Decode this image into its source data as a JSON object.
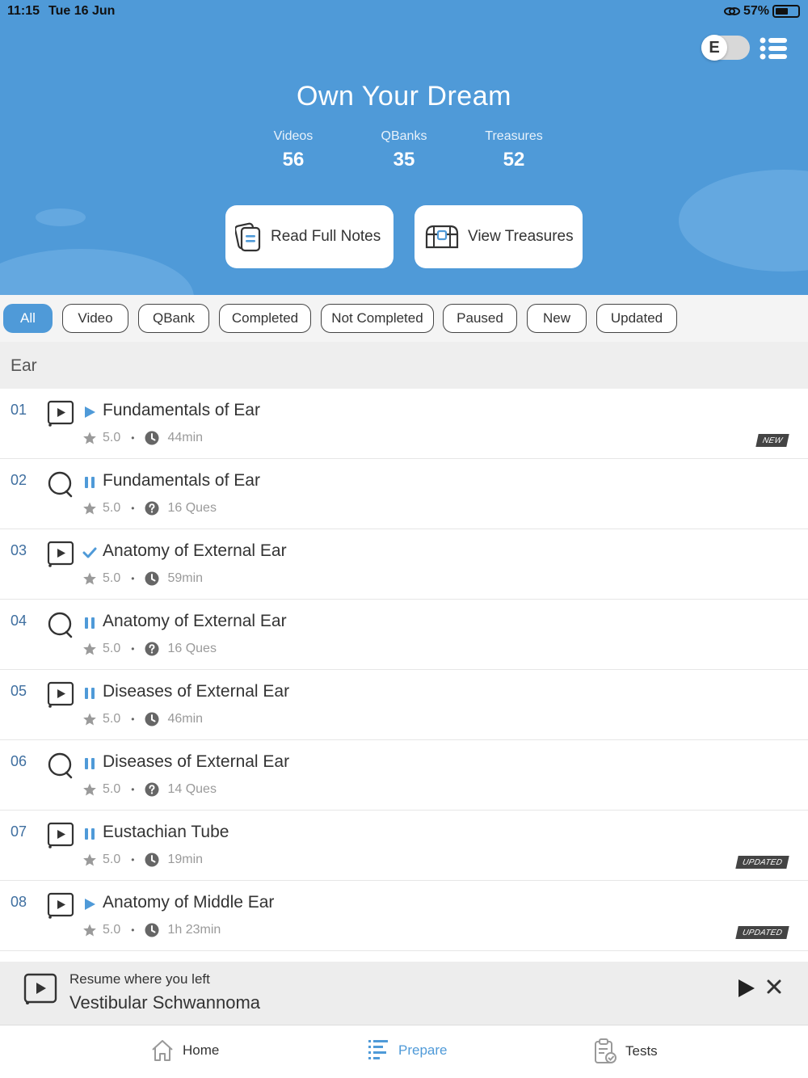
{
  "status_bar": {
    "time": "11:15",
    "date": "Tue 16 Jun",
    "battery": "57%"
  },
  "header": {
    "toggle_letter": "E",
    "title": "Own Your Dream",
    "stats": [
      {
        "label": "Videos",
        "value": "56"
      },
      {
        "label": "QBanks",
        "value": "35"
      },
      {
        "label": "Treasures",
        "value": "52"
      }
    ],
    "read_notes_label": "Read Full Notes",
    "view_treasures_label": "View Treasures"
  },
  "filters": [
    "All",
    "Video",
    "QBank",
    "Completed",
    "Not Completed",
    "Paused",
    "New",
    "Updated"
  ],
  "section_title": "Ear",
  "items": [
    {
      "num": "01",
      "type": "video",
      "status": "play",
      "title": "Fundamentals of Ear",
      "rating": "5.0",
      "meta_icon": "clock",
      "meta": "44min",
      "badge": "NEW"
    },
    {
      "num": "02",
      "type": "qbank",
      "status": "pause",
      "title": "Fundamentals of Ear",
      "rating": "5.0",
      "meta_icon": "question",
      "meta": "16 Ques",
      "badge": ""
    },
    {
      "num": "03",
      "type": "video",
      "status": "check",
      "title": "Anatomy of External Ear",
      "rating": "5.0",
      "meta_icon": "clock",
      "meta": "59min",
      "badge": ""
    },
    {
      "num": "04",
      "type": "qbank",
      "status": "pause",
      "title": "Anatomy of External Ear",
      "rating": "5.0",
      "meta_icon": "question",
      "meta": "16 Ques",
      "badge": ""
    },
    {
      "num": "05",
      "type": "video",
      "status": "pause",
      "title": "Diseases of External Ear",
      "rating": "5.0",
      "meta_icon": "clock",
      "meta": "46min",
      "badge": ""
    },
    {
      "num": "06",
      "type": "qbank",
      "status": "pause",
      "title": "Diseases of External Ear",
      "rating": "5.0",
      "meta_icon": "question",
      "meta": "14 Ques",
      "badge": ""
    },
    {
      "num": "07",
      "type": "video",
      "status": "pause",
      "title": "Eustachian Tube",
      "rating": "5.0",
      "meta_icon": "clock",
      "meta": "19min",
      "badge": "UPDATED"
    },
    {
      "num": "08",
      "type": "video",
      "status": "play",
      "title": "Anatomy of Middle Ear",
      "rating": "5.0",
      "meta_icon": "clock",
      "meta": "1h 23min",
      "badge": "UPDATED"
    }
  ],
  "resume": {
    "label": "Resume where you left",
    "title": "Vestibular Schwannoma"
  },
  "tabs": [
    {
      "label": "Home",
      "icon": "home-icon"
    },
    {
      "label": "Prepare",
      "icon": "prepare-icon"
    },
    {
      "label": "Tests",
      "icon": "tests-icon"
    }
  ],
  "colors": {
    "primary": "#4f9ad8",
    "number": "#3f6fa0",
    "badge": "#444444"
  }
}
